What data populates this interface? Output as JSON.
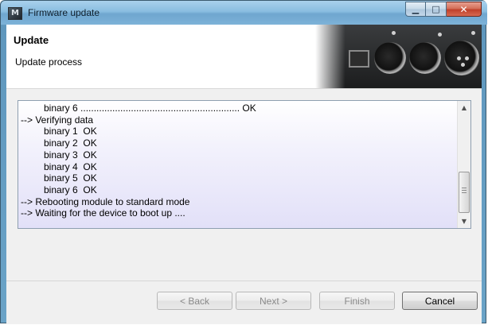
{
  "window": {
    "title": "Firmware update",
    "app_icon_glyph": "M",
    "minimize_glyph": "▁",
    "maximize_glyph": "□",
    "close_glyph": "✕"
  },
  "header": {
    "title": "Update",
    "subtitle": "Update process"
  },
  "log": {
    "lines": [
      {
        "text": "binary 6 ............................................................ OK",
        "indent": true
      },
      {
        "text": "--> Verifying data",
        "indent": false
      },
      {
        "text": "binary 1  OK",
        "indent": true
      },
      {
        "text": "binary 2  OK",
        "indent": true
      },
      {
        "text": "binary 3  OK",
        "indent": true
      },
      {
        "text": "binary 4  OK",
        "indent": true
      },
      {
        "text": "binary 5  OK",
        "indent": true
      },
      {
        "text": "binary 6  OK",
        "indent": true
      },
      {
        "text": "--> Rebooting module to standard mode",
        "indent": false
      },
      {
        "text": "--> Waiting for the device to boot up ....",
        "indent": false
      }
    ],
    "scroll_up_glyph": "▲",
    "scroll_down_glyph": "▼"
  },
  "buttons": {
    "back": "< Back",
    "next": "Next >",
    "finish": "Finish",
    "cancel": "Cancel"
  }
}
